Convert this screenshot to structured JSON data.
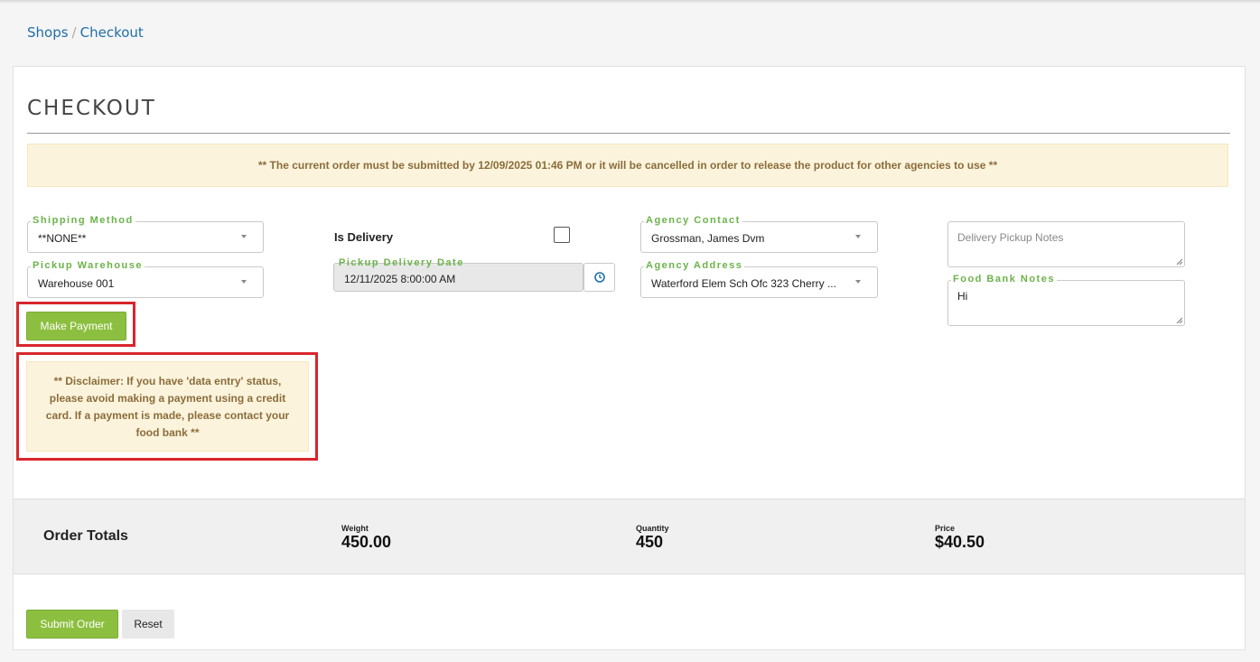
{
  "breadcrumb": {
    "shops": "Shops",
    "separator": "/",
    "checkout": "Checkout"
  },
  "page_title": "CHECKOUT",
  "alert_text": "** The current order must be submitted by 12/09/2025 01:46 PM or it will be cancelled in order to release the product for other agencies to use **",
  "shipping_method": {
    "label": "Shipping Method",
    "value": "**NONE**"
  },
  "pickup_warehouse": {
    "label": "Pickup Warehouse",
    "value": "Warehouse 001"
  },
  "is_delivery": {
    "label": "Is Delivery",
    "checked": false
  },
  "pickup_delivery_date": {
    "label": "Pickup Delivery Date",
    "value": "12/11/2025 8:00:00 AM"
  },
  "agency_contact": {
    "label": "Agency Contact",
    "value": "Grossman, James Dvm"
  },
  "agency_address": {
    "label": "Agency Address",
    "value": "Waterford Elem Sch Ofc 323 Cherry ..."
  },
  "delivery_pickup_notes": {
    "placeholder": "Delivery Pickup Notes",
    "value": ""
  },
  "food_bank_notes": {
    "label": "Food Bank Notes",
    "value": "Hi"
  },
  "make_payment_label": "Make Payment",
  "disclaimer_text": "** Disclaimer: If you have 'data entry' status, please avoid making a payment using a credit card. If a payment is made, please contact your food bank **",
  "order_totals": {
    "heading": "Order Totals",
    "weight_label": "Weight",
    "weight_value": "450.00",
    "quantity_label": "Quantity",
    "quantity_value": "450",
    "price_label": "Price",
    "price_value": "$40.50"
  },
  "submit_label": "Submit Order",
  "reset_label": "Reset",
  "colors": {
    "accent_green": "#8cbf3f",
    "legend_green": "#6bb34a",
    "alert_bg": "#fcf3dc",
    "highlight_red": "#d8262c",
    "link_blue": "#1f6fa8"
  }
}
